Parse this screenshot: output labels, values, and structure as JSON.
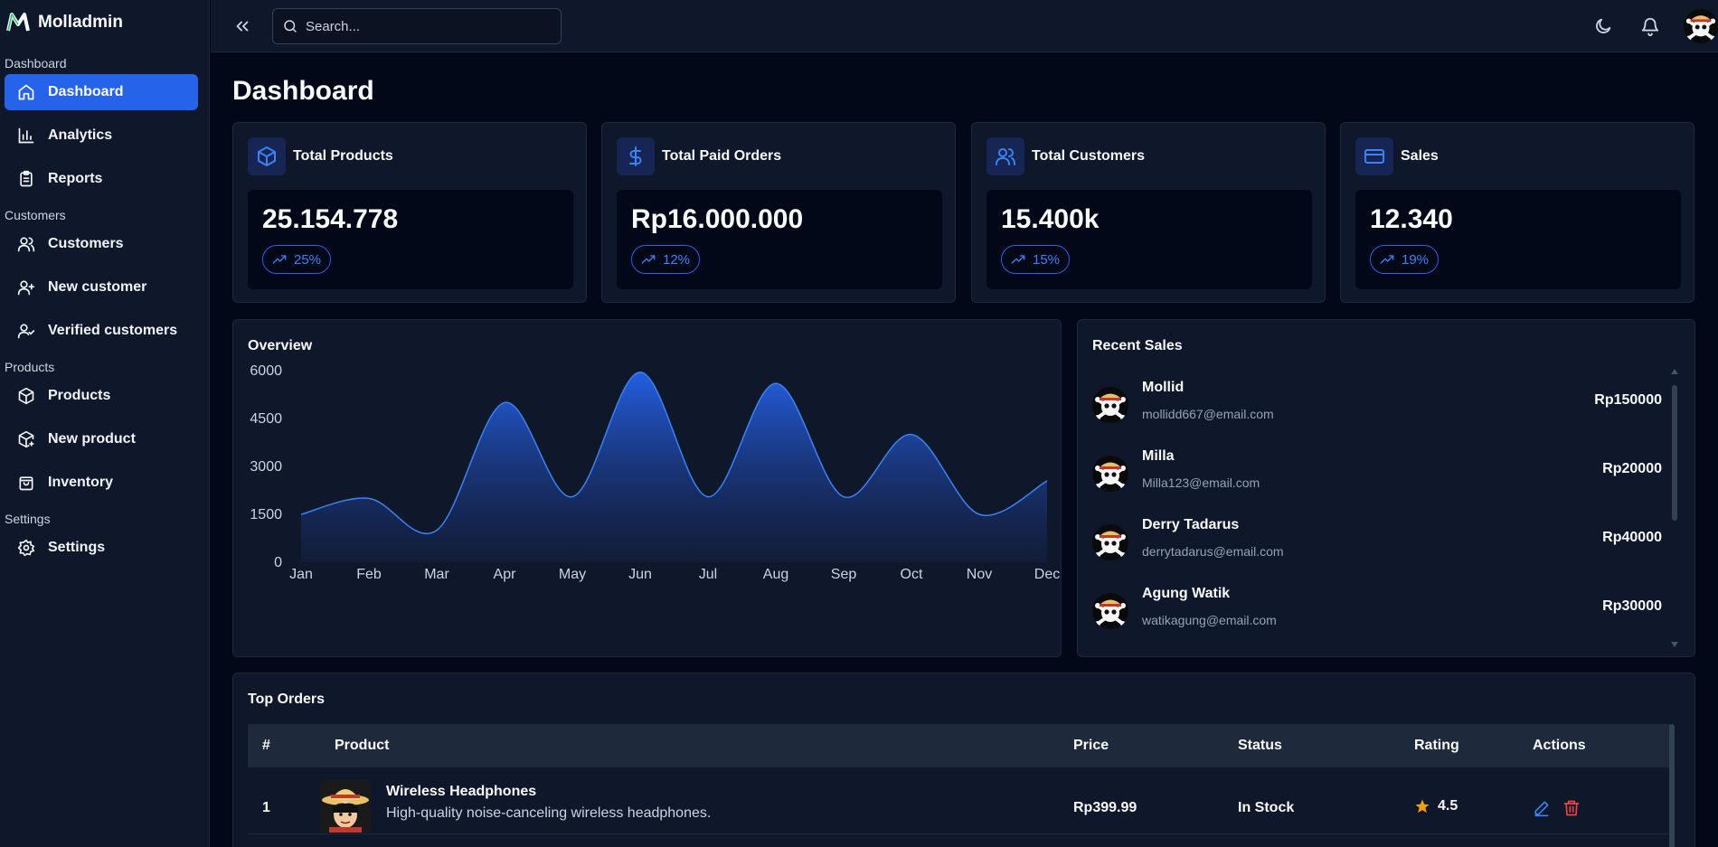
{
  "app": {
    "name": "Molladmin"
  },
  "sidebar": {
    "sections": [
      {
        "label": "Dashboard",
        "items": [
          {
            "label": "Dashboard",
            "icon": "home-icon",
            "active": true
          },
          {
            "label": "Analytics",
            "icon": "bar-chart-icon"
          },
          {
            "label": "Reports",
            "icon": "clipboard-icon"
          }
        ]
      },
      {
        "label": "Customers",
        "items": [
          {
            "label": "Customers",
            "icon": "users-icon"
          },
          {
            "label": "New customer",
            "icon": "user-plus-icon"
          },
          {
            "label": "Verified customers",
            "icon": "user-check-icon"
          }
        ]
      },
      {
        "label": "Products",
        "items": [
          {
            "label": "Products",
            "icon": "package-icon"
          },
          {
            "label": "New product",
            "icon": "package-plus-icon"
          },
          {
            "label": "Inventory",
            "icon": "shopping-bag-icon"
          }
        ]
      },
      {
        "label": "Settings",
        "items": [
          {
            "label": "Settings",
            "icon": "gear-icon"
          }
        ]
      }
    ]
  },
  "topbar": {
    "search_placeholder": "Search..."
  },
  "page": {
    "title": "Dashboard"
  },
  "stats": [
    {
      "title": "Total Products",
      "value": "25.154.778",
      "change": "25%",
      "icon": "package-icon"
    },
    {
      "title": "Total Paid Orders",
      "value": "Rp16.000.000",
      "change": "12%",
      "icon": "dollar-icon"
    },
    {
      "title": "Total Customers",
      "value": "15.400k",
      "change": "15%",
      "icon": "users-icon"
    },
    {
      "title": "Sales",
      "value": "12.340",
      "change": "19%",
      "icon": "credit-card-icon"
    }
  ],
  "overview": {
    "title": "Overview"
  },
  "chart_data": {
    "type": "area",
    "title": "Overview",
    "x": [
      "Jan",
      "Feb",
      "Mar",
      "Apr",
      "May",
      "Jun",
      "Jul",
      "Aug",
      "Sep",
      "Oct",
      "Nov",
      "Dec"
    ],
    "y_ticks": [
      "0",
      "1500",
      "3000",
      "4500",
      "6000"
    ],
    "ylim": [
      0,
      6000
    ],
    "series": [
      {
        "values": [
          1500,
          2000,
          1000,
          5000,
          2050,
          5950,
          2050,
          5600,
          2050,
          4000,
          1500,
          2550
        ],
        "color": "#3b82f6"
      }
    ],
    "grid": false
  },
  "recent_sales": {
    "title": "Recent Sales",
    "items": [
      {
        "name": "Mollid",
        "email": "mollidd667@email.com",
        "amount": "Rp150000"
      },
      {
        "name": "Milla",
        "email": "Milla123@email.com",
        "amount": "Rp20000"
      },
      {
        "name": "Derry Tadarus",
        "email": "derrytadarus@email.com",
        "amount": "Rp40000"
      },
      {
        "name": "Agung Watik",
        "email": "watikagung@email.com",
        "amount": "Rp30000"
      }
    ]
  },
  "top_orders": {
    "title": "Top Orders",
    "columns": [
      "#",
      "Product",
      "Price",
      "Status",
      "Rating",
      "Actions"
    ],
    "rows": [
      {
        "index": "1",
        "product": "Wireless Headphones",
        "description": "High-quality noise-canceling wireless headphones.",
        "price": "Rp399.99",
        "status": "In Stock",
        "rating": "4.5"
      }
    ]
  },
  "colors": {
    "background": "#020817",
    "panel": "#0f172a",
    "accent": "#2563eb",
    "danger": "#ef4444",
    "star": "#f59e0b"
  }
}
